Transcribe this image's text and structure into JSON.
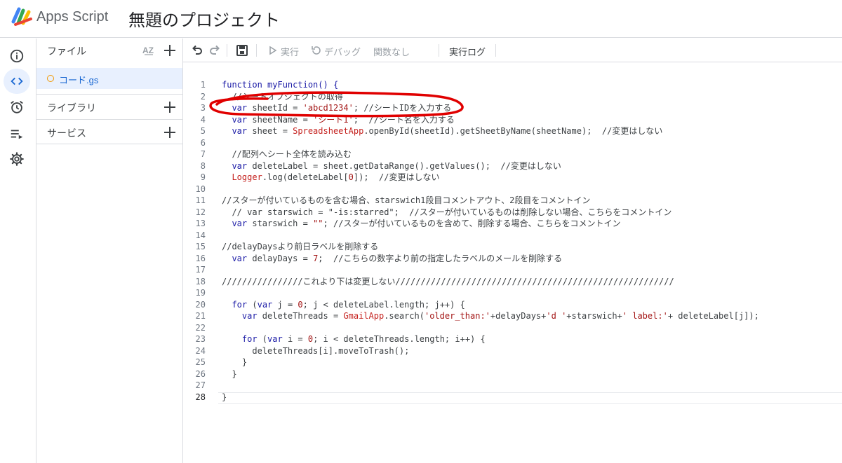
{
  "header": {
    "app_name": "Apps Script",
    "project_title": "無題のプロジェクト"
  },
  "rail": [
    {
      "icon": "info-icon"
    },
    {
      "icon": "code-icon",
      "active": true
    },
    {
      "icon": "alarm-icon"
    },
    {
      "icon": "executions-icon"
    },
    {
      "icon": "gear-icon"
    }
  ],
  "files_panel": {
    "title": "ファイル",
    "sort_label": "AZ",
    "file": {
      "name": "コード.gs",
      "status_color": "#f29900"
    },
    "sections": [
      {
        "label": "ライブラリ"
      },
      {
        "label": "サービス"
      }
    ]
  },
  "toolbar": {
    "run_label": "実行",
    "debug_label": "デバッグ",
    "function_label": "関数なし",
    "log_label": "実行ログ"
  },
  "editor": {
    "current_line": "28",
    "annotation_color": "#e00000",
    "lines": [
      {
        "n": "1",
        "segs": [
          {
            "t": "function myFunction() {",
            "c": "kw"
          }
        ]
      },
      {
        "n": "2",
        "segs": [
          {
            "t": "  //シートオブジェクトの取得",
            "c": "cm"
          }
        ]
      },
      {
        "n": "3",
        "segs": [
          {
            "t": "  var ",
            "c": "kw"
          },
          {
            "t": "sheetId = ",
            "c": ""
          },
          {
            "t": "'abcd1234'",
            "c": "str"
          },
          {
            "t": "; //シートIDを入力する",
            "c": "cm"
          }
        ]
      },
      {
        "n": "4",
        "segs": [
          {
            "t": "  var ",
            "c": "kw"
          },
          {
            "t": "sheetName = ",
            "c": ""
          },
          {
            "t": "'シート1'",
            "c": "str"
          },
          {
            "t": ";  //シート名を入力する",
            "c": "cm"
          }
        ]
      },
      {
        "n": "5",
        "segs": [
          {
            "t": "  var ",
            "c": "kw"
          },
          {
            "t": "sheet = ",
            "c": ""
          },
          {
            "t": "SpreadsheetApp",
            "c": "app"
          },
          {
            "t": ".openById(sheetId).getSheetByName(sheetName);  //変更はしない",
            "c": ""
          }
        ]
      },
      {
        "n": "6",
        "segs": []
      },
      {
        "n": "7",
        "segs": [
          {
            "t": "  //配列へシート全体を読み込む",
            "c": "cm"
          }
        ]
      },
      {
        "n": "8",
        "segs": [
          {
            "t": "  var ",
            "c": "kw"
          },
          {
            "t": "deleteLabel = sheet.getDataRange().getValues();  //変更はしない",
            "c": ""
          }
        ]
      },
      {
        "n": "9",
        "segs": [
          {
            "t": "  ",
            "c": ""
          },
          {
            "t": "Logger",
            "c": "app"
          },
          {
            "t": ".log(deleteLabel[",
            "c": ""
          },
          {
            "t": "0",
            "c": "str"
          },
          {
            "t": "]);  //変更はしない",
            "c": ""
          }
        ]
      },
      {
        "n": "10",
        "segs": []
      },
      {
        "n": "11",
        "segs": [
          {
            "t": "//スターが付いているものを含む場合、starswich1段目コメントアウト、2段目をコメントイン",
            "c": "cm"
          }
        ]
      },
      {
        "n": "12",
        "segs": [
          {
            "t": "  // var starswich = \"-is:starred\";  //スターが付いているものは削除しない場合、こちらをコメントイン",
            "c": "cm"
          }
        ]
      },
      {
        "n": "13",
        "segs": [
          {
            "t": "  var ",
            "c": "kw"
          },
          {
            "t": "starswich = ",
            "c": ""
          },
          {
            "t": "\"\"",
            "c": "str"
          },
          {
            "t": "; //スターが付いているものを含めて、削除する場合、こちらをコメントイン",
            "c": ""
          }
        ]
      },
      {
        "n": "14",
        "segs": []
      },
      {
        "n": "15",
        "segs": [
          {
            "t": "//delayDaysより前日ラベルを削除する",
            "c": "cm"
          }
        ]
      },
      {
        "n": "16",
        "segs": [
          {
            "t": "  var ",
            "c": "kw"
          },
          {
            "t": "delayDays = ",
            "c": ""
          },
          {
            "t": "7",
            "c": "str"
          },
          {
            "t": ";  //こちらの数字より前の指定したラベルのメールを削除する",
            "c": ""
          }
        ]
      },
      {
        "n": "17",
        "segs": []
      },
      {
        "n": "18",
        "segs": [
          {
            "t": "////////////////これより下は変更しない///////////////////////////////////////////////////////",
            "c": "cm"
          }
        ]
      },
      {
        "n": "19",
        "segs": []
      },
      {
        "n": "20",
        "segs": [
          {
            "t": "  for ",
            "c": "kw"
          },
          {
            "t": "(",
            "c": ""
          },
          {
            "t": "var ",
            "c": "kw"
          },
          {
            "t": "j = ",
            "c": ""
          },
          {
            "t": "0",
            "c": "str"
          },
          {
            "t": "; j < deleteLabel.length; j++) {",
            "c": ""
          }
        ]
      },
      {
        "n": "21",
        "segs": [
          {
            "t": "    var ",
            "c": "kw"
          },
          {
            "t": "deleteThreads = ",
            "c": ""
          },
          {
            "t": "GmailApp",
            "c": "app"
          },
          {
            "t": ".search(",
            "c": ""
          },
          {
            "t": "'older_than:'",
            "c": "str"
          },
          {
            "t": "+delayDays+",
            "c": ""
          },
          {
            "t": "'d '",
            "c": "str"
          },
          {
            "t": "+starswich+",
            "c": ""
          },
          {
            "t": "' label:'",
            "c": "str"
          },
          {
            "t": "+ deleteLabel[j]);",
            "c": ""
          }
        ]
      },
      {
        "n": "22",
        "segs": []
      },
      {
        "n": "23",
        "segs": [
          {
            "t": "    for ",
            "c": "kw"
          },
          {
            "t": "(",
            "c": ""
          },
          {
            "t": "var ",
            "c": "kw"
          },
          {
            "t": "i = ",
            "c": ""
          },
          {
            "t": "0",
            "c": "str"
          },
          {
            "t": "; i < deleteThreads.length; i++) {",
            "c": ""
          }
        ]
      },
      {
        "n": "24",
        "segs": [
          {
            "t": "      deleteThreads[i].moveToTrash();",
            "c": ""
          }
        ]
      },
      {
        "n": "25",
        "segs": [
          {
            "t": "    }",
            "c": ""
          }
        ]
      },
      {
        "n": "26",
        "segs": [
          {
            "t": "  }",
            "c": ""
          }
        ]
      },
      {
        "n": "27",
        "segs": []
      },
      {
        "n": "28",
        "segs": [
          {
            "t": "}",
            "c": ""
          }
        ]
      }
    ]
  }
}
